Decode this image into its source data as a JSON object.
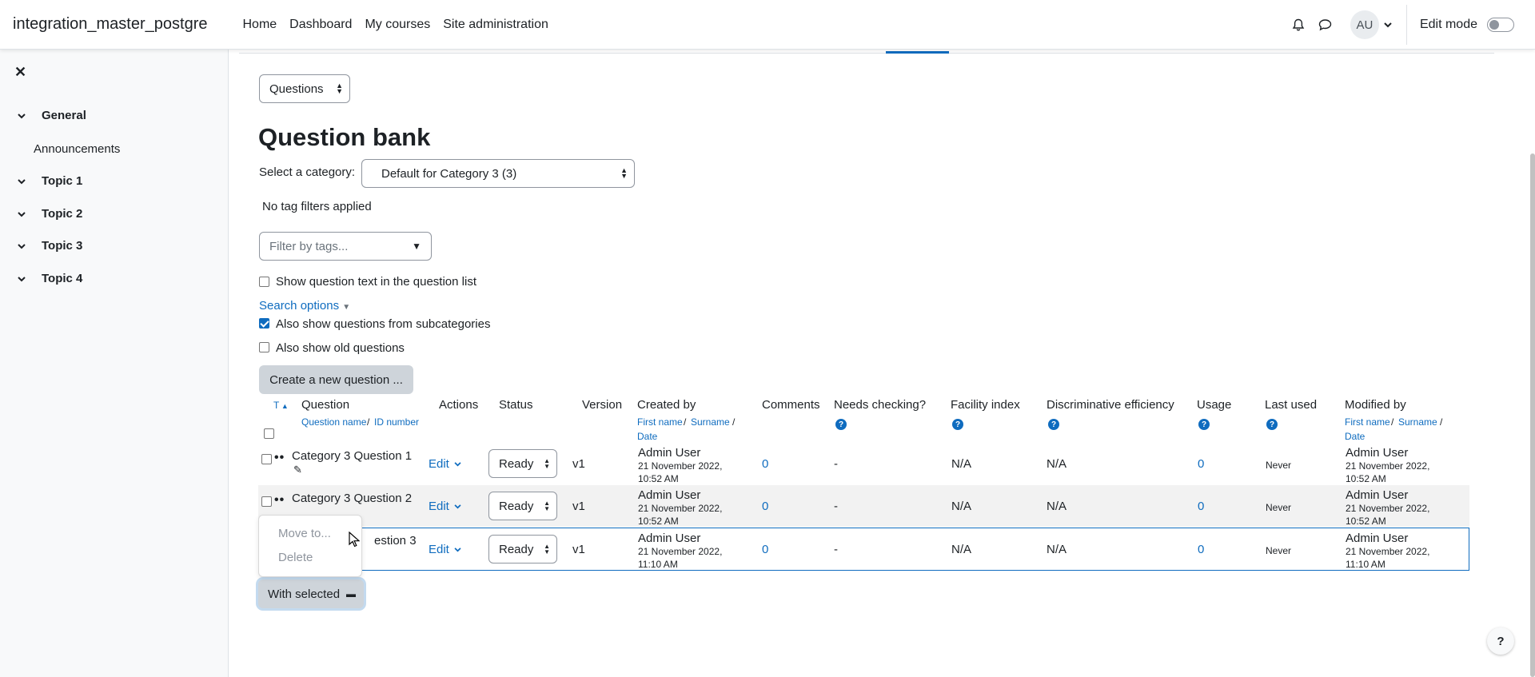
{
  "navbar": {
    "brand": "integration_master_postgre",
    "links": [
      "Home",
      "Dashboard",
      "My courses",
      "Site administration"
    ],
    "avatar": "AU",
    "edit_mode": "Edit mode"
  },
  "drawer": {
    "sections": [
      {
        "label": "General",
        "items": [
          "Announcements"
        ]
      },
      {
        "label": "Topic 1"
      },
      {
        "label": "Topic 2"
      },
      {
        "label": "Topic 3"
      },
      {
        "label": "Topic 4"
      }
    ]
  },
  "page": {
    "nav_select": "Questions",
    "title": "Question bank",
    "category_label": "Select a category:",
    "category_value": "Default for Category 3 (3)",
    "no_tag": "No tag filters applied",
    "filter_placeholder": "Filter by tags...",
    "show_text": "Show question text in the question list",
    "search_options": "Search options",
    "subcats": "Also show questions from subcategories",
    "old": "Also show old questions",
    "create_btn": "Create a new question ...",
    "with_selected": "With selected"
  },
  "table": {
    "headers": {
      "t": "T",
      "question": "Question",
      "question_name": "Question name",
      "id_number": "ID number",
      "actions": "Actions",
      "status": "Status",
      "version": "Version",
      "created_by": "Created by",
      "first_name": "First name",
      "surname": "Surname",
      "date": "Date",
      "comments": "Comments",
      "needs_checking": "Needs checking?",
      "facility": "Facility index",
      "discrim": "Discriminative efficiency",
      "usage": "Usage",
      "last_used": "Last used",
      "modified_by": "Modified by"
    },
    "rows": [
      {
        "name": "Category 3 Question 1",
        "edit": "Edit",
        "status": "Ready",
        "version": "v1",
        "creator": "Admin User",
        "created_date": "21 November 2022,",
        "created_time": "10:52 AM",
        "comments": "0",
        "needs": "-",
        "facility": "N/A",
        "discrim": "N/A",
        "usage": "0",
        "last_used": "Never",
        "modifier": "Admin User",
        "modified_date": "21 November 2022,",
        "modified_time": "10:52 AM"
      },
      {
        "name": "Category 3 Question 2",
        "edit": "Edit",
        "status": "Ready",
        "version": "v1",
        "creator": "Admin User",
        "created_date": "21 November 2022,",
        "created_time": "10:52 AM",
        "comments": "0",
        "needs": "-",
        "facility": "N/A",
        "discrim": "N/A",
        "usage": "0",
        "last_used": "Never",
        "modifier": "Admin User",
        "modified_date": "21 November 2022,",
        "modified_time": "10:52 AM"
      },
      {
        "name": "estion 3",
        "edit": "Edit",
        "status": "Ready",
        "version": "v1",
        "creator": "Admin User",
        "created_date": "21 November 2022,",
        "created_time": "11:10 AM",
        "comments": "0",
        "needs": "-",
        "facility": "N/A",
        "discrim": "N/A",
        "usage": "0",
        "last_used": "Never",
        "modifier": "Admin User",
        "modified_date": "21 November 2022,",
        "modified_time": "11:10 AM"
      }
    ]
  },
  "menu": {
    "items": [
      "Move to...",
      "Delete"
    ]
  }
}
